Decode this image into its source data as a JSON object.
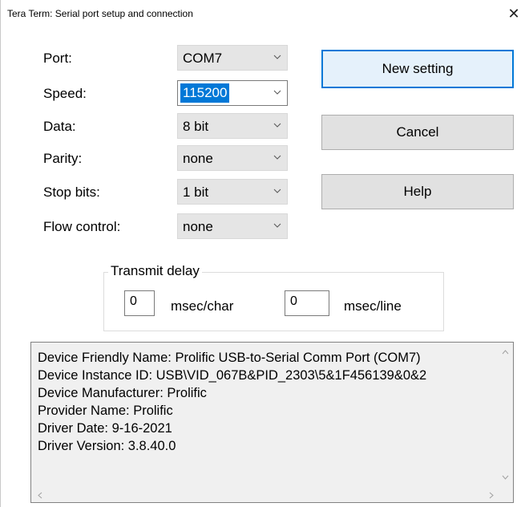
{
  "window": {
    "title": "Tera Term: Serial port setup and connection",
    "close_glyph": "✕"
  },
  "form": {
    "port": {
      "label": "Port:",
      "value": "COM7"
    },
    "speed": {
      "label": "Speed:",
      "value": "115200"
    },
    "data": {
      "label": "Data:",
      "value": "8 bit"
    },
    "parity": {
      "label": "Parity:",
      "value": "none"
    },
    "stop_bits": {
      "label": "Stop bits:",
      "value": "1 bit"
    },
    "flow_control": {
      "label": "Flow control:",
      "value": "none"
    }
  },
  "buttons": {
    "new_setting": "New setting",
    "cancel": "Cancel",
    "help": "Help"
  },
  "transmit_delay": {
    "title": "Transmit delay",
    "char_value": "0",
    "char_unit": "msec/char",
    "line_value": "0",
    "line_unit": "msec/line"
  },
  "device_info": [
    "Device Friendly Name: Prolific USB-to-Serial Comm Port (COM7)",
    "Device Instance ID: USB\\VID_067B&PID_2303\\5&1F456139&0&2",
    "Device Manufacturer: Prolific",
    "Provider Name: Prolific",
    "Driver Date: 9-16-2021",
    "Driver Version: 3.8.40.0"
  ],
  "colors": {
    "accent": "#0078d7",
    "button_bg": "#e1e1e1",
    "combo_bg": "#e5e5e5"
  }
}
